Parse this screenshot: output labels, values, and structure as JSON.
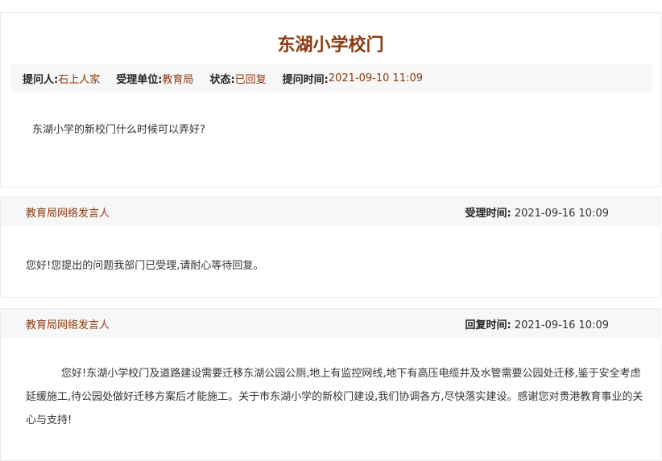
{
  "title": "东湖小学校门",
  "meta": {
    "asker_label": "提问人:",
    "asker": "石上人家",
    "dept_label": "受理单位:",
    "dept": "教育局",
    "status_label": "状态:",
    "status": "已回复",
    "asked_label": "提问时间:",
    "asked_time": "2021-09-10 11:09"
  },
  "question": "东湖小学的新校门什么时候可以弄好?",
  "accept": {
    "responder": "教育局网络发言人",
    "time_label": "受理时间:",
    "time": "2021-09-16 10:09",
    "text": "您好!您提出的问题我部门已受理,请耐心等待回复。"
  },
  "reply": {
    "responder": "教育局网络发言人",
    "time_label": "回复时间:",
    "time": "2021-09-16 10:09",
    "text": "您好!东湖小学校门及道路建设需要迁移东湖公园公厕,地上有监控网线,地下有高压电缆井及水管需要公园处迁移,鉴于安全考虑延缓施工,待公园处做好迁移方案后才能施工。关于市东湖小学的新校门建设,我们协调各方,尽快落实建设。感谢您对贵港教育事业的关心与支持!"
  }
}
